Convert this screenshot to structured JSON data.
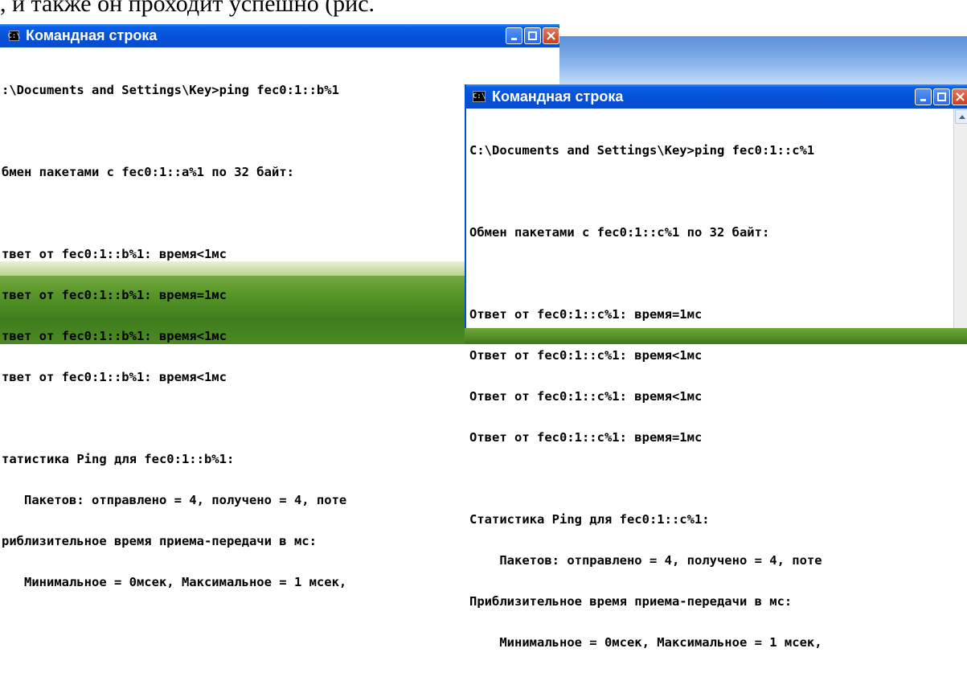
{
  "doc_fragment": ", и также он проходит успешно (рис.",
  "window_a": {
    "title": "Командная строка",
    "lines": [
      ":\\Documents and Settings\\Key>ping fec0:1::b%1",
      "",
      "бмен пакетами с fec0:1::a%1 по 32 байт:",
      "",
      "твет от fec0:1::b%1: время<1мс",
      "твет от fec0:1::b%1: время=1мс",
      "твет от fec0:1::b%1: время<1мс",
      "твет от fec0:1::b%1: время<1мс",
      "",
      "татистика Ping для fec0:1::b%1:",
      "   Пакетов: отправлено = 4, получено = 4, поте",
      "риблизительное время приема-передачи в мс:",
      "   Минимальное = 0мсек, Максимальное = 1 мсек,"
    ]
  },
  "window_b": {
    "title": "Командная строка",
    "lines": [
      "C:\\Documents and Settings\\Key>ping fec0:1::c%1",
      "",
      "Обмен пакетами с fec0:1::c%1 по 32 байт:",
      "",
      "Ответ от fec0:1::c%1: время=1мс",
      "Ответ от fec0:1::c%1: время<1мс",
      "Ответ от fec0:1::c%1: время<1мс",
      "Ответ от fec0:1::c%1: время=1мс",
      "",
      "Статистика Ping для fec0:1::c%1:",
      "    Пакетов: отправлено = 4, получено = 4, поте",
      "Приблизительное время приема-передачи в мс:",
      "    Минимальное = 0мсек, Максимальное = 1 мсек,"
    ]
  },
  "icons": {
    "window_icon": "console-icon",
    "minimize": "minimize-icon",
    "maximize": "maximize-icon",
    "close": "close-icon"
  },
  "colors": {
    "titlebar": "#0450d6",
    "close_button": "#c8401e",
    "console_bg": "#ffffff",
    "console_text": "#000000"
  }
}
